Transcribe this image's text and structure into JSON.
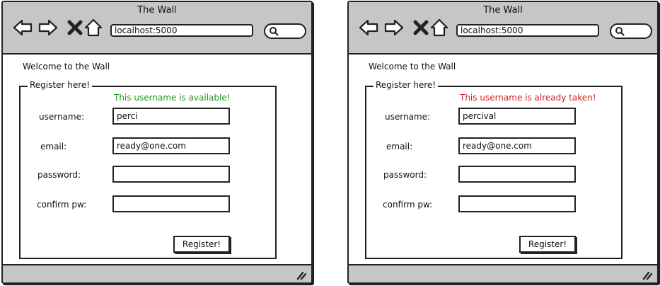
{
  "windows": [
    {
      "title": "The Wall",
      "address": "localhost:5000",
      "welcome": "Welcome to the Wall",
      "legend": "Register here!",
      "status_message": "This username is available!",
      "status_type": "success",
      "fields": {
        "username_label": "username:",
        "username_value": "perci",
        "email_label": "email:",
        "email_value": "ready@one.com",
        "password_label": "password:",
        "password_value": "",
        "confirm_label": "confirm pw:",
        "confirm_value": ""
      },
      "register_label": "Register!"
    },
    {
      "title": "The Wall",
      "address": "localhost:5000",
      "welcome": "Welcome to the Wall",
      "legend": "Register here!",
      "status_message": "This username is already taken!",
      "status_type": "error",
      "fields": {
        "username_label": "username:",
        "username_value": "percival",
        "email_label": "email:",
        "email_value": "ready@one.com",
        "password_label": "password:",
        "password_value": "",
        "confirm_label": "confirm pw:",
        "confirm_value": ""
      },
      "register_label": "Register!"
    }
  ],
  "icons": {
    "back": "back-arrow-icon",
    "forward": "forward-arrow-icon",
    "stop": "stop-x-icon",
    "home": "home-icon",
    "search": "search-icon",
    "resize": "resize-grip-icon"
  },
  "colors": {
    "success": "#1f9a1f",
    "error": "#d42020",
    "chrome": "#c6c6c6"
  }
}
